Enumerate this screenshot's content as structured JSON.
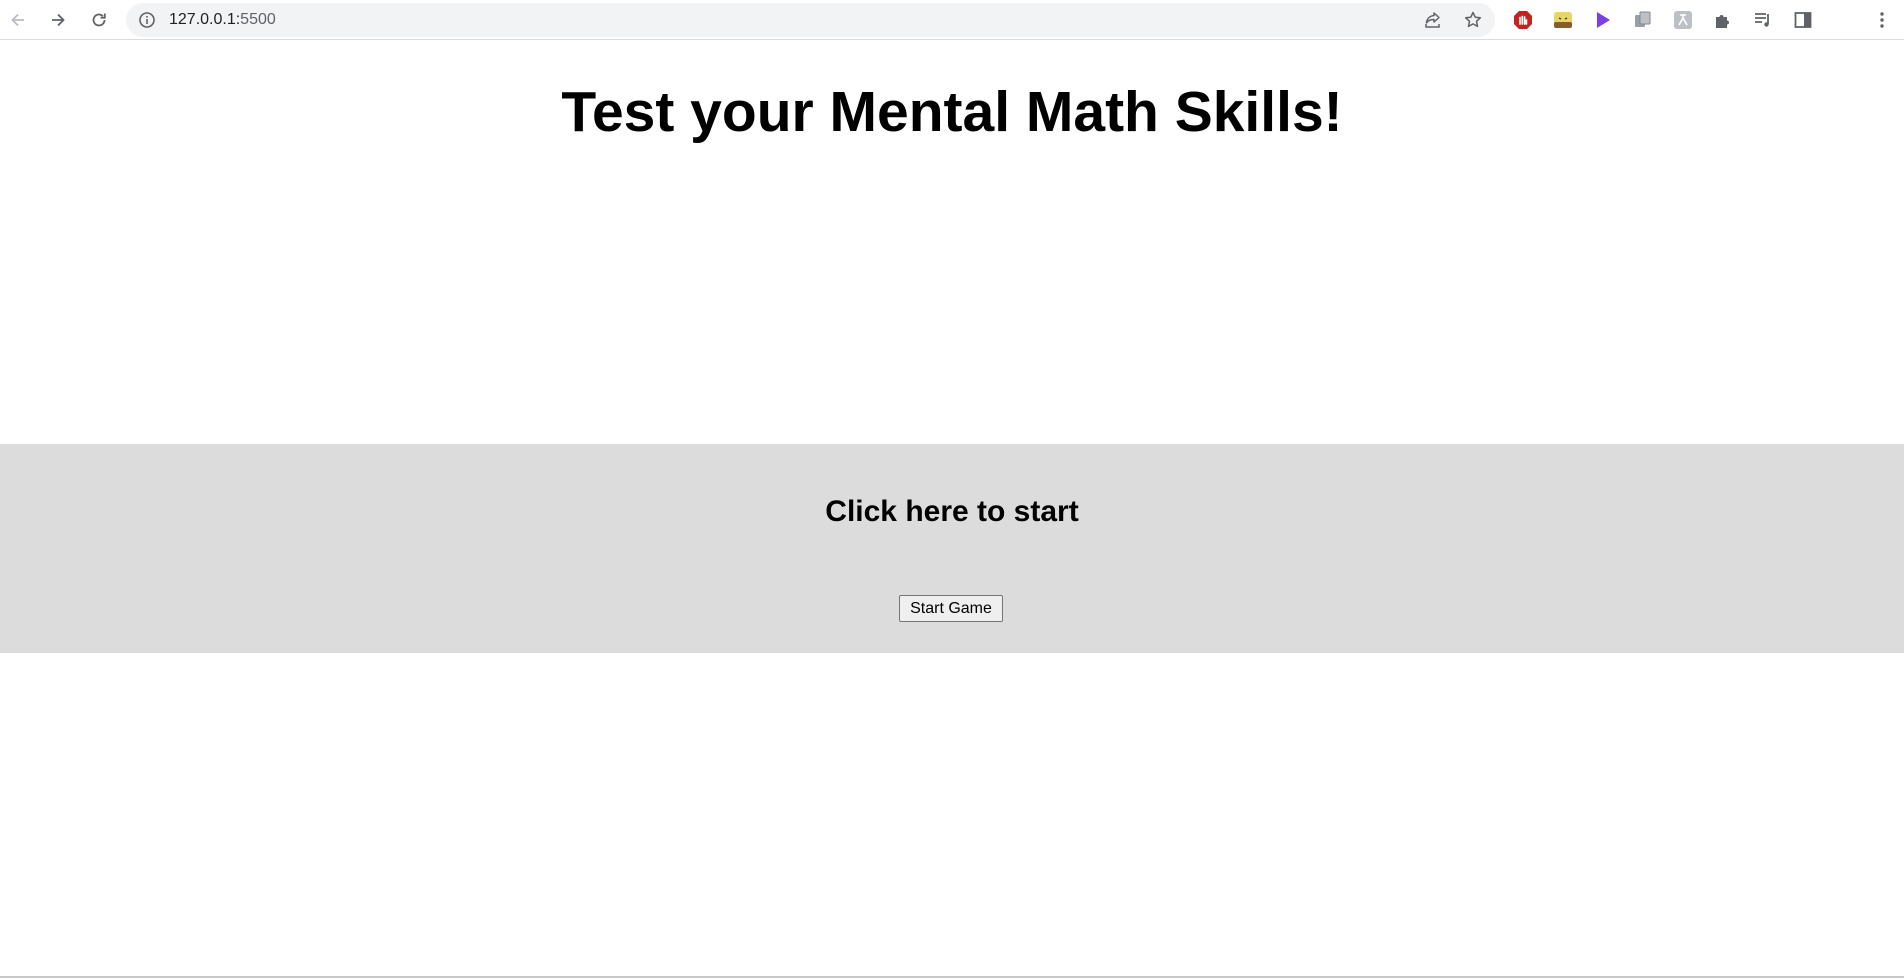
{
  "browser": {
    "url_host": "127.0.0.1:",
    "url_port": "5500",
    "icons": {
      "back": "back-arrow-icon",
      "forward": "forward-arrow-icon",
      "reload": "reload-icon",
      "site_info": "info-icon",
      "share": "share-icon",
      "bookmark": "star-icon",
      "extensions": [
        "adblock-extension-icon",
        "emoji-extension-icon",
        "play-extension-icon",
        "copy-extension-icon",
        "translate-extension-icon",
        "puzzle-icon",
        "media-queue-icon",
        "side-panel-icon",
        "kebab-menu-icon"
      ]
    }
  },
  "page": {
    "title": "Test your Mental Math Skills!",
    "start_panel": {
      "heading": "Click here to start",
      "button_label": "Start Game",
      "background_color": "#dcdcdc"
    }
  }
}
